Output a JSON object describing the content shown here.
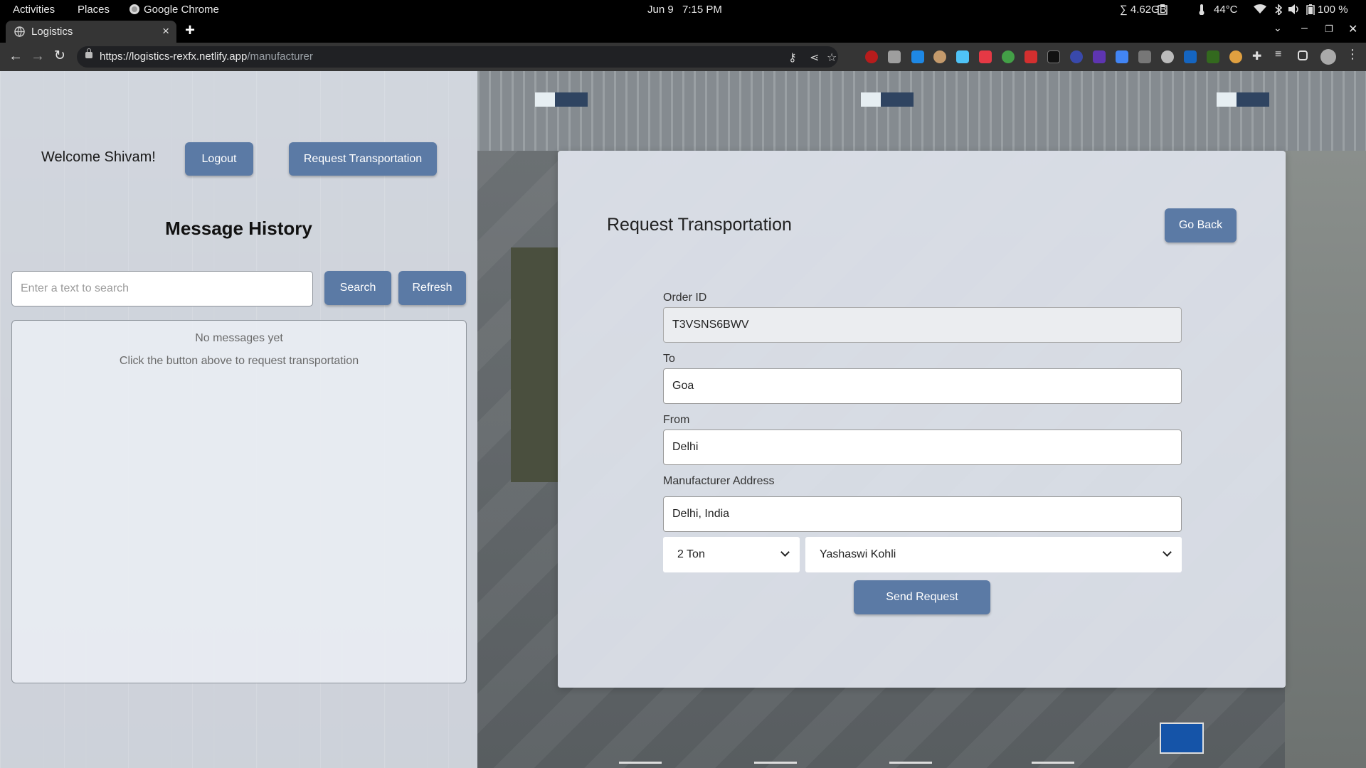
{
  "system_bar": {
    "activities": "Activities",
    "places": "Places",
    "app": "Google Chrome",
    "date": "Jun 9",
    "time": "7:15 PM",
    "memory": "∑ 4.62GB",
    "temperature": "44°C",
    "battery": "100 %"
  },
  "browser": {
    "tab_title": "Logistics",
    "url_host": "https://logistics-rexfx.netlify.app",
    "url_path": "/manufacturer"
  },
  "header": {
    "welcome": "Welcome Shivam!",
    "logout_label": "Logout",
    "request_label": "Request Transportation"
  },
  "history": {
    "title": "Message History",
    "search_placeholder": "Enter a text to search",
    "search_label": "Search",
    "refresh_label": "Refresh",
    "empty_line1": "No messages yet",
    "empty_line2": "Click the button above to request transportation"
  },
  "form": {
    "title": "Request Transportation",
    "go_back_label": "Go Back",
    "order_id_label": "Order ID",
    "order_id_value": "T3VSNS6BWV",
    "to_label": "To",
    "to_value": "Goa",
    "from_label": "From",
    "from_value": "Delhi",
    "address_label": "Manufacturer Address",
    "address_value": "Delhi, India",
    "quantity_value": "2 Ton",
    "transporter_value": "Yashaswi Kohli",
    "send_label": "Send Request"
  },
  "colors": {
    "button": "#5b7aa5",
    "panel": "#dfe4ec"
  }
}
